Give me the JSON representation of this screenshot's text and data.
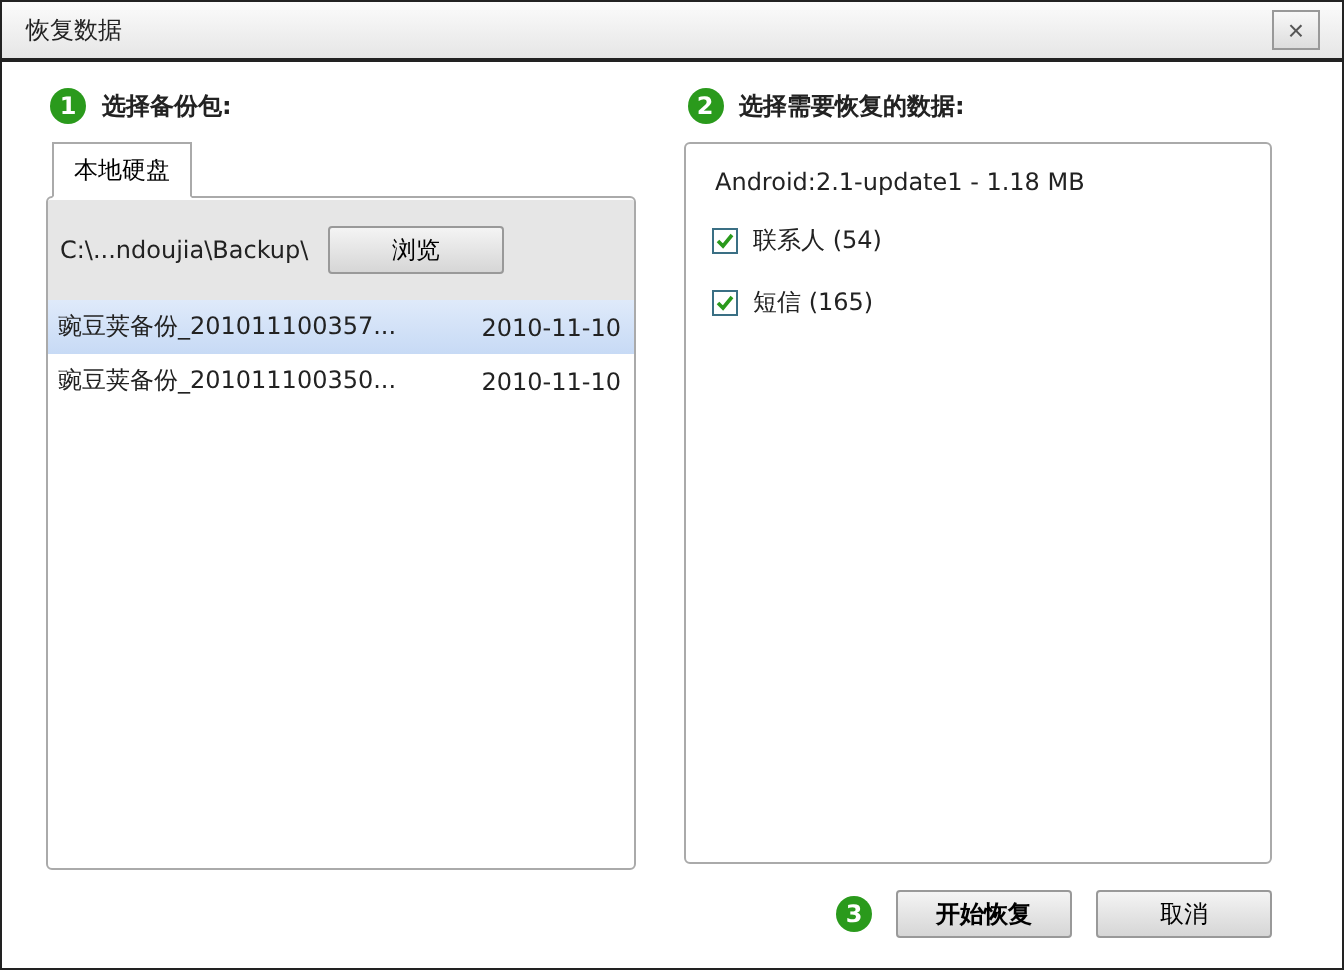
{
  "window": {
    "title": "恢复数据",
    "close": "×"
  },
  "step1": {
    "number": "1",
    "label": "选择备份包:",
    "tabs": [
      {
        "label": "本地硬盘",
        "selected": true
      }
    ],
    "path": "C:\\...ndoujia\\Backup\\",
    "browse": "浏览",
    "backups": [
      {
        "name": "豌豆荚备份_201011100357...",
        "date": "2010-11-10",
        "selected": true
      },
      {
        "name": "豌豆荚备份_201011100350...",
        "date": "2010-11-10",
        "selected": false
      }
    ]
  },
  "step2": {
    "number": "2",
    "label": "选择需要恢复的数据:",
    "info": "Android:2.1-update1 - 1.18 MB",
    "items": [
      {
        "label": "联系人 (54)",
        "checked": true
      },
      {
        "label": "短信 (165)",
        "checked": true
      }
    ]
  },
  "step3": {
    "number": "3"
  },
  "buttons": [
    {
      "label": "开始恢复",
      "kind": "primary"
    },
    {
      "label": "取消",
      "kind": "normal"
    }
  ]
}
